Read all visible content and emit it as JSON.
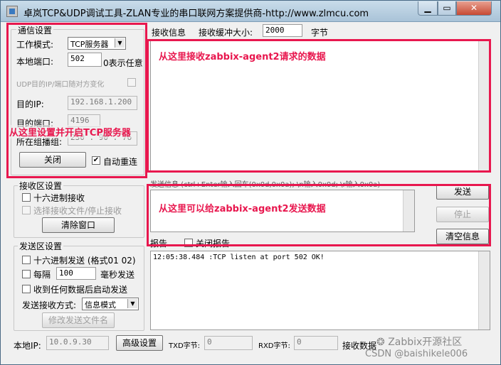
{
  "window": {
    "title": "卓岚TCP&UDP调试工具-ZLAN专业的串口联网方案提供商-http://www.zlmcu.com"
  },
  "comm": {
    "group_title": "通信设置",
    "mode_label": "工作模式:",
    "mode_value": "TCP服务器",
    "port_label": "本地端口:",
    "port_value": "502",
    "port_hint": "0表示任意",
    "udp_random_label": "UDP目的IP/端口随对方变化",
    "dest_ip_label": "目的IP:",
    "dest_ip_value": "192.168.1.200",
    "dest_port_label": "目的端口:",
    "dest_port_value": "4196",
    "multicast_label": "所在组播组:",
    "multicast_value": "230 . 90 . 76 . 1",
    "close_button": "关闭",
    "auto_reconnect_label": "自动重连",
    "auto_reconnect_checked": "✔"
  },
  "recv_settings": {
    "group_title": "接收区设置",
    "hex_recv_label": "十六进制接收",
    "select_file_label": "选择接收文件/停止接收",
    "clear_button": "清除窗口"
  },
  "send_settings": {
    "group_title": "发送区设置",
    "hex_send_label": "十六进制发送 (格式01 02)",
    "every_label": "每隔",
    "every_value": "100",
    "ms_label": "毫秒发送",
    "after_recv_label": "收到任何数据后启动发送",
    "method_label": "发送接收方式:",
    "method_value": "信息模式",
    "modify_file_button": "修改发送文件名"
  },
  "recv_info": {
    "label": "接收信息",
    "buffer_label": "接收缓冲大小:",
    "buffer_value": "2000",
    "unit": "字节"
  },
  "send_info": {
    "label": "发送信息 (ctrl+Enter输入回车(0x0d,0x0a); \\n输入0x0d; \\r输入0x0a)",
    "send_button": "发送",
    "stop_button": "停止",
    "clear_info_button": "清空信息"
  },
  "report": {
    "label": "报告",
    "close_report_label": "关闭报告",
    "log": "12:05:38.484 :TCP listen at port 502 OK!"
  },
  "statusbar": {
    "local_ip_label": "本地IP:",
    "local_ip_value": "10.0.9.30",
    "advanced_button": "高级设置",
    "txd_label": "TXD字节:",
    "txd_value": "0",
    "rxd_label": "RXD字节:",
    "rxd_value": "0",
    "recv_data_label": "接收数据"
  },
  "annotations": {
    "recv_note": "从这里接收zabbix-agent2请求的数据",
    "server_note": "从这里设置并开启TCP服务器",
    "send_note": "从这里可以给zabbix-agent2发送数据",
    "color": "#e8174e"
  },
  "watermark": {
    "brand": "Zabbix开源社区",
    "csdn": "CSDN @baishikele006"
  }
}
